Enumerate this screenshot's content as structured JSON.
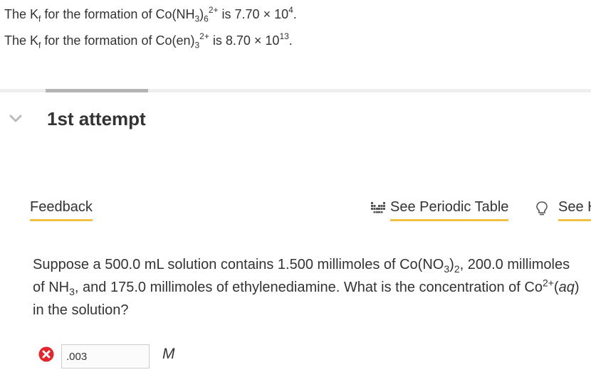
{
  "given": {
    "line1": {
      "pre": "The K",
      "k_sub": "f",
      "mid": " for the formation of Co(NH",
      "nh_sub": "3",
      "paren_close": ")",
      "six_sub": "6",
      "charge": "2+",
      "is": " is 7.70 × 10",
      "exp": "4",
      "end": "."
    },
    "line2": {
      "pre": "The K",
      "k_sub": "f",
      "mid": " for the formation of Co(en)",
      "three_sub": "3",
      "charge": "2+",
      "is": " is 8.70 × 10",
      "exp": "13",
      "end": "."
    }
  },
  "attempt": {
    "title": "1st attempt",
    "chevron_icon": "chevron-down-icon"
  },
  "toolbar": {
    "feedback_label": "Feedback",
    "periodic_label": "See Periodic Table",
    "periodic_icon": "periodic-table-icon",
    "hint_label": "See H",
    "hint_icon": "lightbulb-icon"
  },
  "question": {
    "p1": "Suppose a 500.0 mL solution contains 1.500 millimoles of Co(NO",
    "p1_sub": "3",
    "p1b": ")",
    "p1_sub2": "2",
    "p2": ", 200.0 millimoles of NH",
    "p2_sub": "3",
    "p3": ", and 175.0 millimoles of ethylenediamine. What is the concentration of Co",
    "charge": "2+",
    "p4": "(",
    "aq": "aq",
    "p5": ") in the solution?"
  },
  "answer": {
    "value": ".003",
    "unit": "M",
    "status_icon": "error-icon",
    "status_color": "#e5242b"
  },
  "colors": {
    "accent": "#f2c042",
    "divider": "#eeeeee",
    "tab": "#b5b5b5"
  }
}
